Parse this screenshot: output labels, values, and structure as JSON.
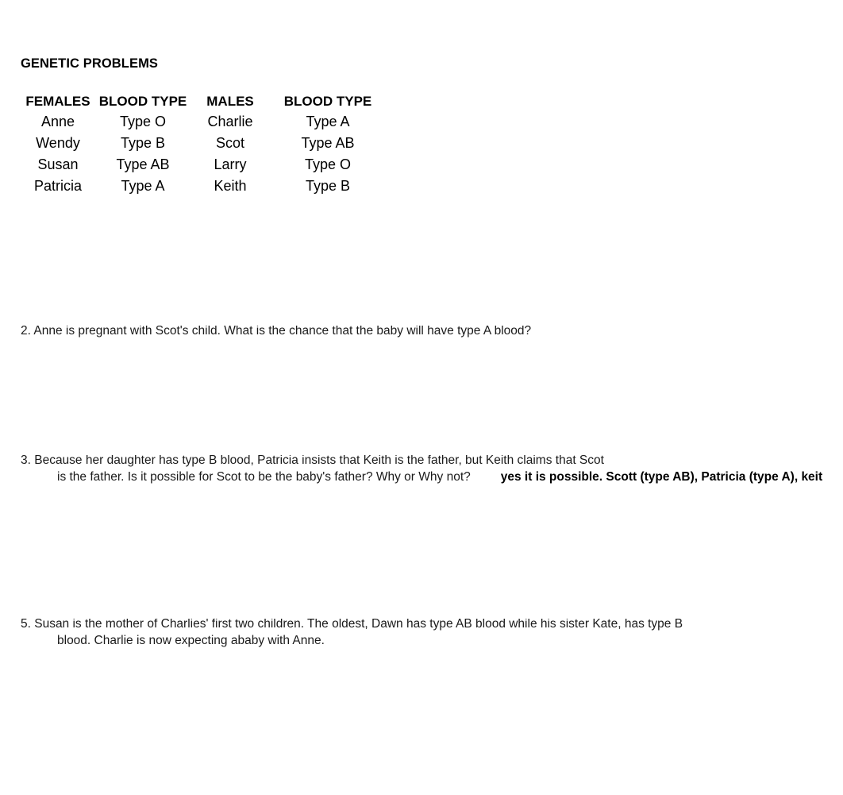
{
  "document": {
    "title": "GENETIC PROBLEMS"
  },
  "table": {
    "headers": {
      "females": "FEMALES",
      "females_blood_type": "BLOOD TYPE",
      "males": "MALES",
      "males_blood_type": "BLOOD TYPE"
    },
    "rows": [
      {
        "female": "Anne",
        "female_blood_type": "Type O",
        "male": "Charlie",
        "male_blood_type": "Type A"
      },
      {
        "female": "Wendy",
        "female_blood_type": "Type B",
        "male": "Scot",
        "male_blood_type": "Type AB"
      },
      {
        "female": "Susan",
        "female_blood_type": "Type AB",
        "male": "Larry",
        "male_blood_type": "Type O"
      },
      {
        "female": "Patricia",
        "female_blood_type": "Type A",
        "male": "Keith",
        "male_blood_type": "Type B"
      }
    ]
  },
  "questions": {
    "q2": {
      "line1": "2. Anne is pregnant with Scot's child. What is the chance that the baby will have type A blood?"
    },
    "q3": {
      "line1": "3. Because her daughter has type B blood, Patricia insists that Keith is the father, but Keith claims that Scot",
      "line2": "is the father. Is it possible for Scot to be the baby's father? Why or Why not?",
      "answer": "yes it is possible. Scott (type AB), Patricia (type A), keith (typ"
    },
    "q5": {
      "line1": "5. Susan is the mother of Charlies' first two children. The oldest, Dawn has type AB blood while his sister Kate, has type B",
      "line2": "blood. Charlie is now expecting ababy with Anne."
    }
  },
  "colors": {
    "background": "#ffffff",
    "text": "#000000",
    "body_text": "#1a1a1a"
  }
}
